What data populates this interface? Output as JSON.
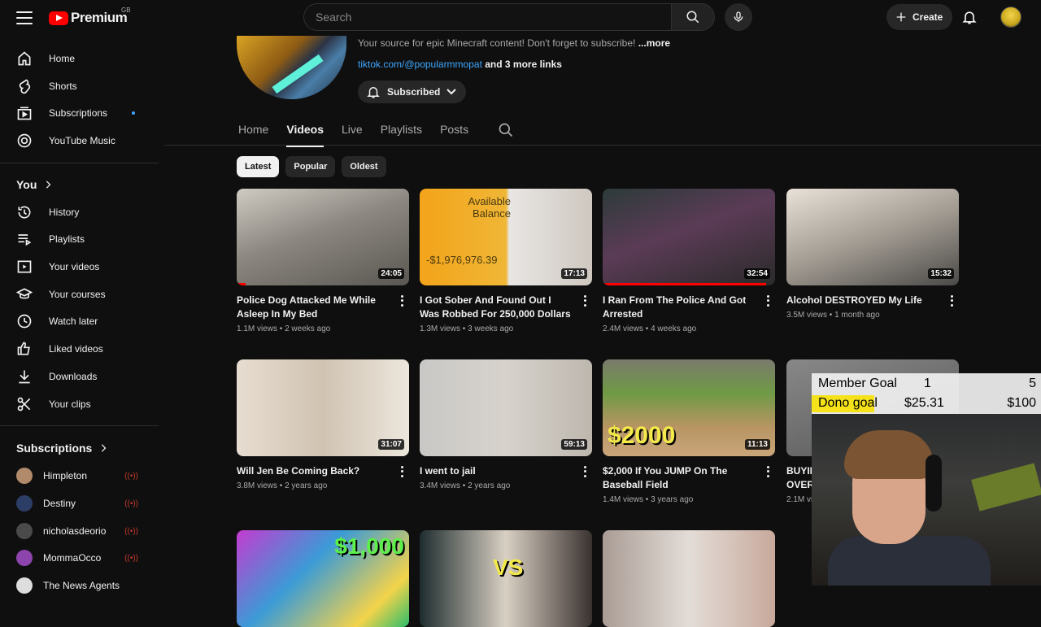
{
  "header": {
    "logo_text": "Premium",
    "country": "GB",
    "search_placeholder": "Search",
    "create_label": "Create"
  },
  "sidebar": {
    "main": [
      {
        "label": "Home",
        "icon": "home-icon"
      },
      {
        "label": "Shorts",
        "icon": "shorts-icon"
      },
      {
        "label": "Subscriptions",
        "icon": "subscriptions-icon"
      },
      {
        "label": "YouTube Music",
        "icon": "youtube-music-icon"
      }
    ],
    "you_heading": "You",
    "you": [
      {
        "label": "History",
        "icon": "history-icon"
      },
      {
        "label": "Playlists",
        "icon": "playlists-icon"
      },
      {
        "label": "Your videos",
        "icon": "your-videos-icon"
      },
      {
        "label": "Your courses",
        "icon": "courses-icon"
      },
      {
        "label": "Watch later",
        "icon": "watch-later-icon"
      },
      {
        "label": "Liked videos",
        "icon": "thumbs-up-icon"
      },
      {
        "label": "Downloads",
        "icon": "download-icon"
      },
      {
        "label": "Your clips",
        "icon": "scissors-icon"
      }
    ],
    "subs_heading": "Subscriptions",
    "subscriptions": [
      {
        "label": "Himpleton",
        "color": "#b08a6a"
      },
      {
        "label": "Destiny",
        "color": "#2c3e66"
      },
      {
        "label": "nicholasdeorio",
        "color": "#4a4a4a"
      },
      {
        "label": "MommaOcco",
        "color": "#8e44ad"
      },
      {
        "label": "The News Agents",
        "color": "#dddddd"
      }
    ]
  },
  "channel": {
    "description": "Your source for epic Minecraft content!  Don't forget to subscribe!",
    "more": "...more",
    "link": "tiktok.com/@popularmmopat",
    "more_links": "and 3 more links",
    "subscribe_label": "Subscribed"
  },
  "tabs": [
    "Home",
    "Videos",
    "Live",
    "Playlists",
    "Posts"
  ],
  "active_tab": "Videos",
  "chips": [
    "Latest",
    "Popular",
    "Oldest"
  ],
  "active_chip": "Latest",
  "videos": [
    {
      "title": "Police Dog Attacked Me While Asleep In My Bed",
      "meta": "1.1M views • 2 weeks ago",
      "duration": "24:05",
      "watched": 0.05,
      "bg": "linear-gradient(160deg,#cfcac2 0%,#8c8780 45%,#5a5752 100%)",
      "overlay": ""
    },
    {
      "title": "I Got Sober And Found Out I Was Robbed For 250,000 Dollars",
      "meta": "1.3M views • 3 weeks ago",
      "duration": "17:13",
      "watched": 0,
      "bg": "linear-gradient(90deg,#f3a41a 0%,#f0b636 50%,#e8e6e4 52%,#cfc8c0 100%)",
      "overlay": "Available Balance",
      "overlay2": "-$1,976,976.39"
    },
    {
      "title": "I Ran From The Police And Got Arrested",
      "meta": "2.4M views • 4 weeks ago",
      "duration": "32:54",
      "watched": 0.95,
      "bg": "linear-gradient(160deg,#2d3b3a 0%,#5b3b56 45%,#2a2a2a 100%)",
      "overlay": ""
    },
    {
      "title": "Alcohol DESTROYED My Life",
      "meta": "3.5M views • 1 month ago",
      "duration": "15:32",
      "watched": 0,
      "bg": "linear-gradient(160deg,#e8e2d8 0%,#a39c93 50%,#4b4a48 100%)",
      "overlay": ""
    },
    {
      "title": "Will Jen Be Coming Back?",
      "meta": "3.8M views • 2 years ago",
      "duration": "31:07",
      "watched": 0,
      "bg": "linear-gradient(90deg,#e7ddd0 0%,#d0c3b2 50%,#ece6dc 100%)",
      "overlay": ""
    },
    {
      "title": "I went to jail",
      "meta": "3.4M views • 2 years ago",
      "duration": "59:13",
      "watched": 0,
      "bg": "linear-gradient(90deg,#c9c8c6 0%,#d7d2cc 50%,#bdb7ae 100%)",
      "overlay": ""
    },
    {
      "title": "$2,000 If You JUMP On The Baseball Field",
      "meta": "1.4M views • 3 years ago",
      "duration": "11:13",
      "watched": 0,
      "bg": "linear-gradient(180deg,#7a7a6c 0%,#6f9a45 35%,#b89563 70%,#caa67a 100%)",
      "overlay": "$2000"
    },
    {
      "title": "BUYING EVERYTHING OVERTIME",
      "meta": "2.1M views • 3 years ago",
      "duration": "",
      "watched": 0,
      "bg": "linear-gradient(160deg,#888 0%,#555 100%)",
      "overlay": ""
    },
    {
      "title": "",
      "meta": "",
      "duration": "",
      "watched": 0,
      "bg": "linear-gradient(135deg,#c43bd0 0%,#3b9bd6 40%,#f3d34a 80%,#2dbd6a 100%)",
      "overlay": "$1,000"
    },
    {
      "title": "",
      "meta": "",
      "duration": "",
      "watched": 0,
      "bg": "linear-gradient(90deg,#1e2c2e 0%,#d9d0c3 50%,#3a3230 100%)",
      "overlay": "VS"
    },
    {
      "title": "",
      "meta": "",
      "duration": "",
      "watched": 0,
      "bg": "linear-gradient(90deg,#a99c95 0%,#e3ddd7 50%,#c8a99c 100%)",
      "overlay": ""
    }
  ],
  "stream_overlay": {
    "member_label": "Member Goal",
    "member_current": "1",
    "member_target": "5",
    "dono_label": "Dono goal",
    "dono_current": "$25.31",
    "dono_target": "$100",
    "dono_progress": 0.25
  }
}
